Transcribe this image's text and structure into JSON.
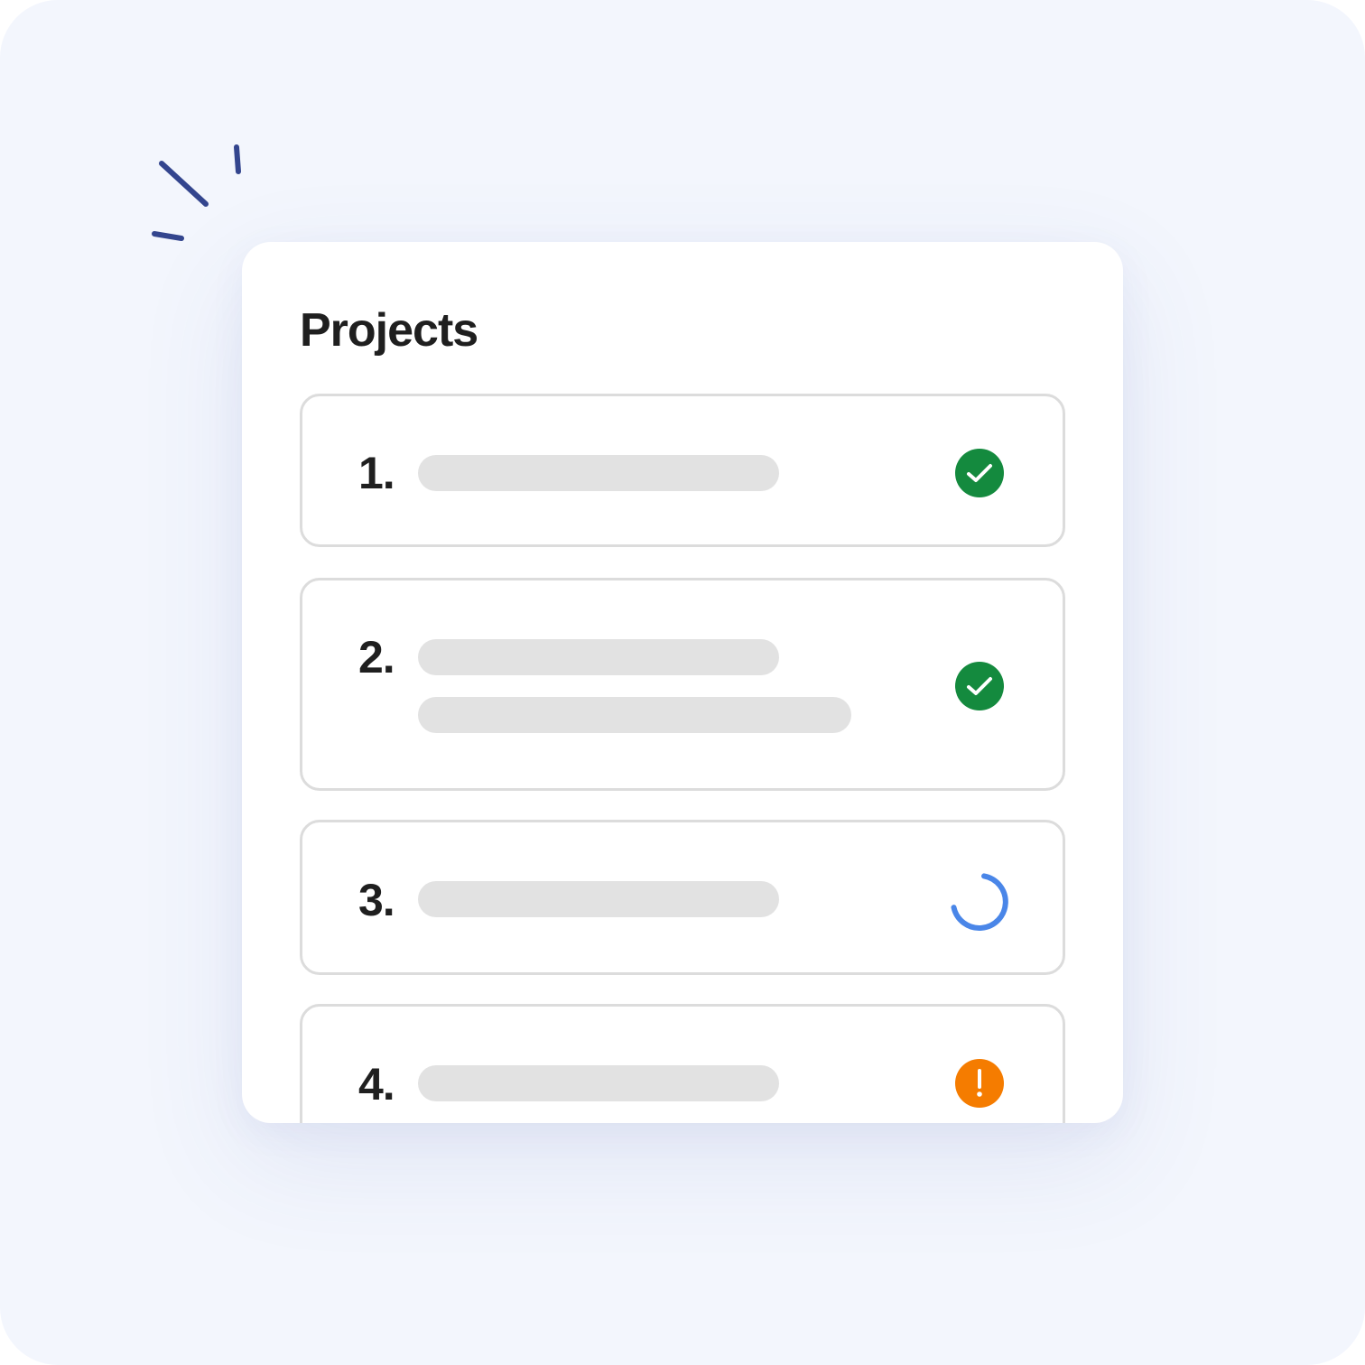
{
  "card": {
    "title": "Projects"
  },
  "projects": [
    {
      "number": "1.",
      "status": "check-circle-icon",
      "status_color": "#148a3e",
      "placeholder_lines": 1
    },
    {
      "number": "2.",
      "status": "check-circle-icon",
      "status_color": "#148a3e",
      "placeholder_lines": 2
    },
    {
      "number": "3.",
      "status": "loading-spinner-icon",
      "status_color": "#4a86e8",
      "placeholder_lines": 1
    },
    {
      "number": "4.",
      "status": "alert-circle-icon",
      "status_color": "#f57c00",
      "placeholder_lines": 1
    }
  ],
  "colors": {
    "background": "#f3f6fd",
    "sparkle": "#33458e",
    "placeholder": "#e2e2e2",
    "border": "#dcdcdc"
  }
}
